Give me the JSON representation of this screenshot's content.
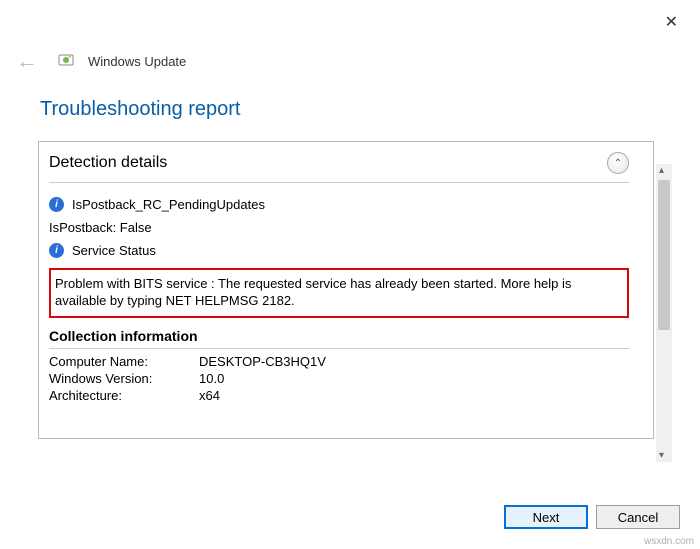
{
  "close": "✕",
  "back_arrow": "←",
  "window_title": "Windows Update",
  "heading": "Troubleshooting report",
  "section": {
    "title": "Detection details",
    "chevron": "⌃"
  },
  "items": {
    "pending": "IsPostback_RC_PendingUpdates",
    "postback": "IsPostback: False",
    "service": "Service Status"
  },
  "problem_text": "Problem with BITS service : The requested service has already been started. More help is available by typing NET HELPMSG 2182.",
  "collection": {
    "title": "Collection information",
    "computer_label": "Computer Name:",
    "computer_value": "DESKTOP-CB3HQ1V",
    "winver_label": "Windows Version:",
    "winver_value": "10.0",
    "arch_label": "Architecture:",
    "arch_value": "x64"
  },
  "buttons": {
    "next": "Next",
    "cancel": "Cancel"
  },
  "watermark": "wsxdn.com"
}
